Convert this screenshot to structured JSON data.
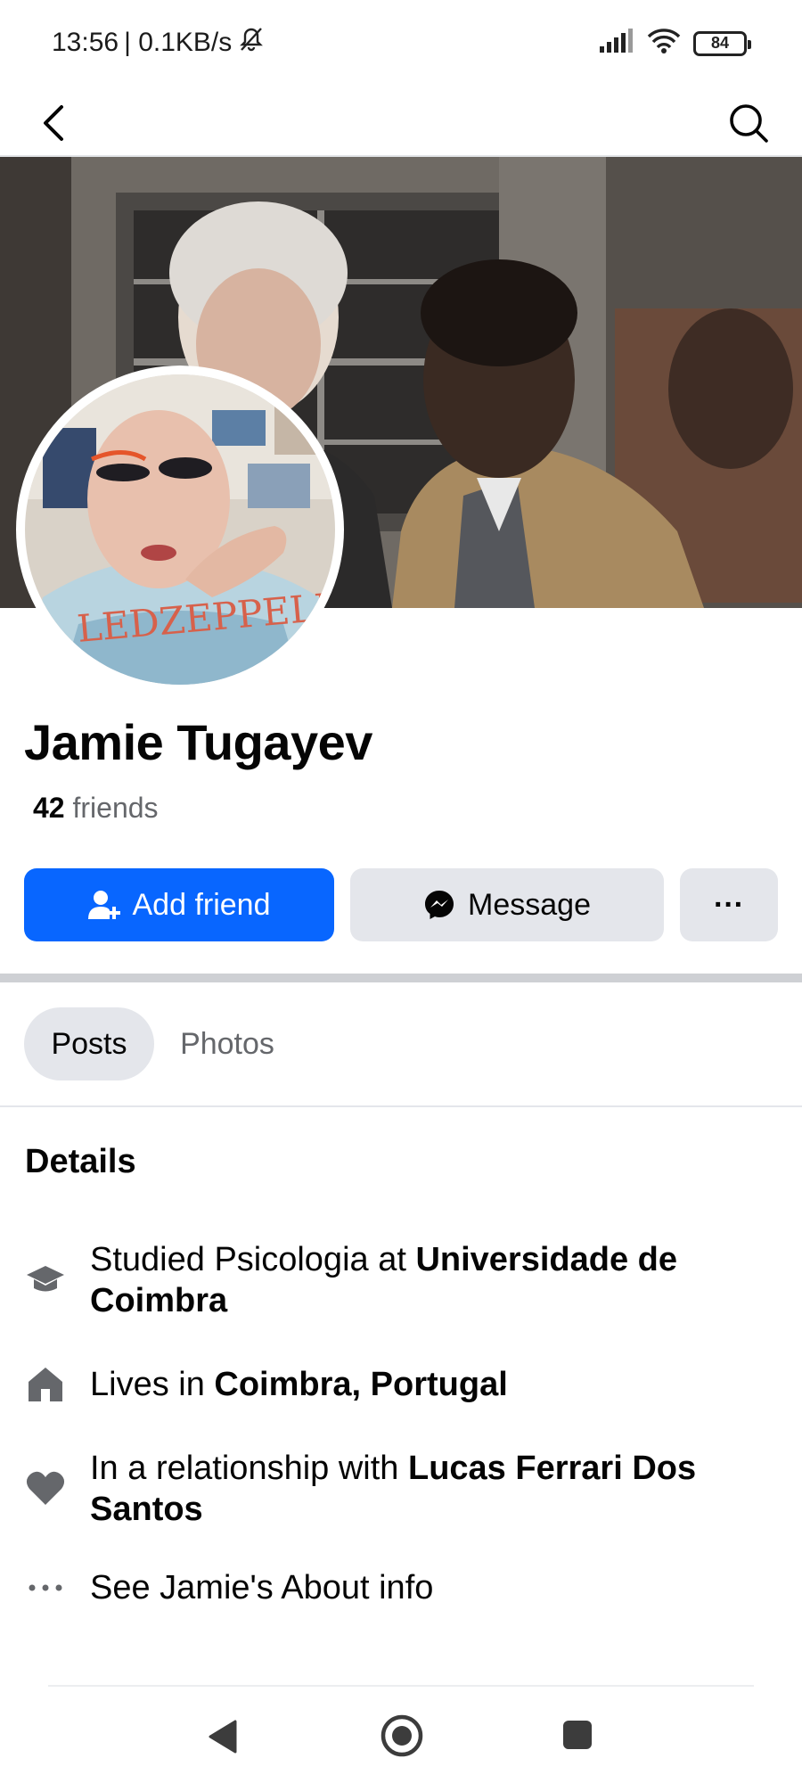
{
  "status_bar": {
    "time": "13:56",
    "network_speed": "| 0.1KB/s",
    "battery": "84",
    "icons": [
      "mute-icon",
      "signal-icon",
      "wifi-icon",
      "battery-icon"
    ]
  },
  "header": {
    "back_icon": "chevron-left-icon",
    "search_icon": "search-icon"
  },
  "profile": {
    "name": "Jamie Tugayev",
    "friends_count": "42",
    "friends_label": "friends"
  },
  "actions": {
    "add_friend": "Add friend",
    "message": "Message",
    "more": "···"
  },
  "tabs": [
    {
      "label": "Posts",
      "active": true
    },
    {
      "label": "Photos",
      "active": false
    }
  ],
  "details": {
    "title": "Details",
    "education": {
      "prefix": "Studied Psicologia at ",
      "bold": "Universidade de Coimbra"
    },
    "location": {
      "prefix": "Lives in ",
      "bold": "Coimbra, Portugal"
    },
    "relationship": {
      "prefix": "In a relationship with ",
      "bold": "Lucas Ferrari Dos Santos"
    },
    "about": "See Jamie's About info"
  },
  "colors": {
    "accent": "#0866ff",
    "button_gray": "#e4e6eb",
    "secondary_text": "#65676b",
    "icon_gray": "#65676b"
  }
}
